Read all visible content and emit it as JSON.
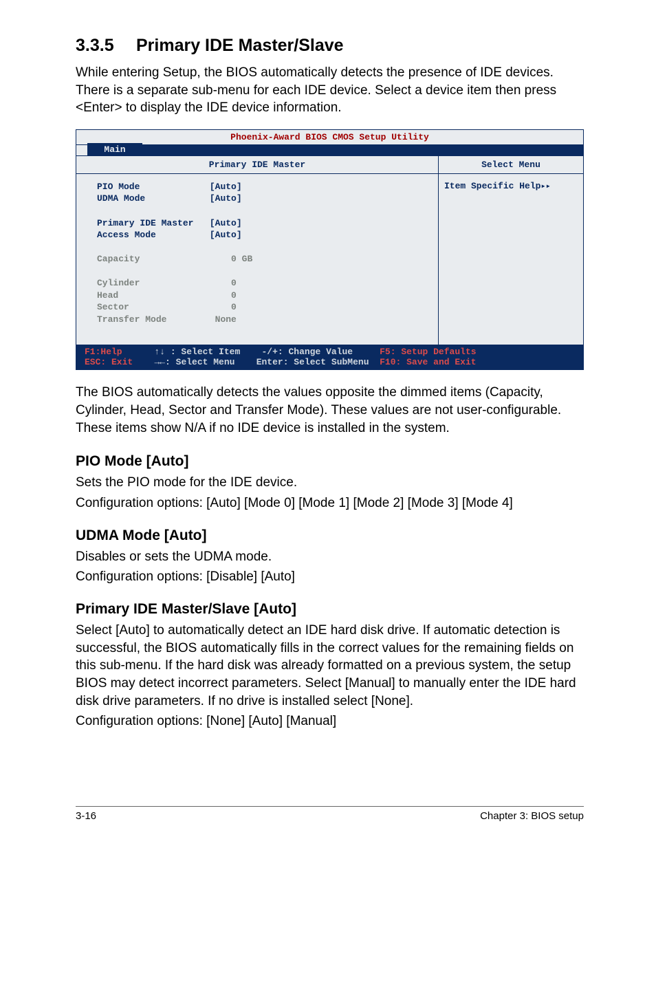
{
  "section": {
    "number": "3.3.5",
    "title": "Primary IDE Master/Slave"
  },
  "intro": "While entering Setup, the BIOS automatically detects the presence of IDE devices. There is a separate sub-menu for each IDE device. Select a device item then press <Enter> to display the IDE device information.",
  "bios": {
    "title": "Phoenix-Award BIOS CMOS Setup Utility",
    "tab": "Main",
    "left_header": "Primary IDE Master",
    "right_header": "Select Menu",
    "right_body": "Item Specific Help",
    "items": {
      "pio_label": "PIO Mode",
      "pio_val": "[Auto]",
      "udma_label": "UDMA Mode",
      "udma_val": "[Auto]",
      "pim_label": "Primary IDE Master",
      "pim_val": "[Auto]",
      "acc_label": "Access Mode",
      "acc_val": "[Auto]",
      "cap_label": "Capacity",
      "cap_val": "0 GB",
      "cyl_label": "Cylinder",
      "cyl_val": "0",
      "head_label": "Head",
      "head_val": "0",
      "sec_label": "Sector",
      "sec_val": "0",
      "tm_label": "Transfer Mode",
      "tm_val": "None"
    },
    "footer": {
      "f1": "F1:Help",
      "sel_item": "↑↓ : Select Item",
      "change": "-/+: Change Value",
      "f5": "F5: Setup Defaults",
      "esc": "ESC: Exit",
      "sel_menu": "→←: Select Menu",
      "enter": "Enter: Select SubMenu",
      "f10": "F10: Save and Exit"
    }
  },
  "after_bios": "The BIOS automatically detects the values opposite the dimmed items (Capacity, Cylinder,  Head, Sector and Transfer Mode). These values are not user-configurable. These items show N/A if no IDE device is installed in the system.",
  "pio": {
    "heading": "PIO Mode [Auto]",
    "l1": "Sets the PIO mode for the IDE device.",
    "l2": "Configuration options: [Auto] [Mode 0] [Mode 1] [Mode 2] [Mode 3] [Mode 4]"
  },
  "udma": {
    "heading": "UDMA Mode [Auto]",
    "l1": "Disables or sets the UDMA mode.",
    "l2": "Configuration options: [Disable] [Auto]"
  },
  "pide": {
    "heading": "Primary IDE Master/Slave [Auto]",
    "body": "Select [Auto] to automatically detect an IDE hard disk drive. If automatic detection is successful, the BIOS automatically fills in the correct values for the remaining fields on this sub-menu. If the hard disk was already formatted on a previous system, the setup BIOS may detect incorrect parameters. Select [Manual] to manually enter the IDE hard disk drive parameters. If no drive is installed select [None].",
    "cfg": "Configuration options: [None] [Auto] [Manual]"
  },
  "footer": {
    "left": "3-16",
    "right": "Chapter 3: BIOS setup"
  }
}
